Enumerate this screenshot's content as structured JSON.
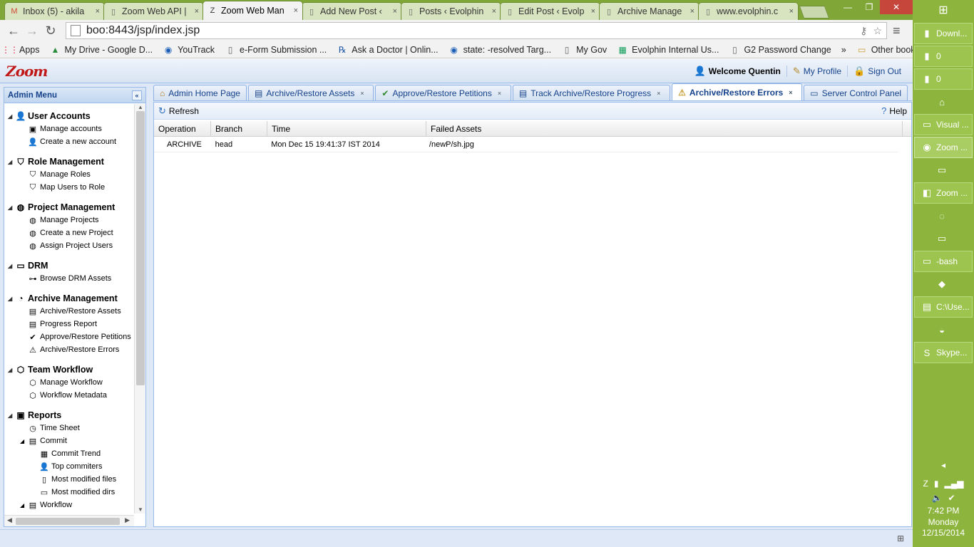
{
  "browser": {
    "tabs": [
      {
        "title": "Inbox (5) - akila",
        "icon": "gmail-icon",
        "glyph": "M",
        "color": "#d14836"
      },
      {
        "title": "Zoom Web API |",
        "icon": "page-icon",
        "glyph": "▯",
        "color": "#666"
      },
      {
        "title": "Zoom Web Man",
        "icon": "zoom-z-icon",
        "glyph": "Z",
        "color": "#333",
        "active": true
      },
      {
        "title": "Add New Post ‹",
        "icon": "page-icon",
        "glyph": "▯",
        "color": "#666"
      },
      {
        "title": "Posts ‹ Evolphin",
        "icon": "page-icon",
        "glyph": "▯",
        "color": "#666"
      },
      {
        "title": "Edit Post ‹ Evolp",
        "icon": "page-icon",
        "glyph": "▯",
        "color": "#666"
      },
      {
        "title": "Archive Manage",
        "icon": "page-icon",
        "glyph": "▯",
        "color": "#666"
      },
      {
        "title": "www.evolphin.c",
        "icon": "page-icon",
        "glyph": "▯",
        "color": "#666"
      }
    ],
    "tab_close": "×",
    "url": "boo:8443/jsp/index.jsp",
    "bookmarks": [
      {
        "label": "Apps",
        "icon": "apps-grid-icon",
        "glyph": "⋮⋮",
        "color": "#d24"
      },
      {
        "label": "My Drive - Google D...",
        "icon": "google-drive-icon",
        "glyph": "▲",
        "color": "#2a8c3a"
      },
      {
        "label": "YouTrack",
        "icon": "youtrack-icon",
        "glyph": "◉",
        "color": "#1b5fb8"
      },
      {
        "label": "e-Form Submission ...",
        "icon": "page-icon",
        "glyph": "▯",
        "color": "#666"
      },
      {
        "label": "Ask a Doctor | Onlin...",
        "icon": "rx-icon",
        "glyph": "℞",
        "color": "#1e57a8"
      },
      {
        "label": "state: -resolved Targ...",
        "icon": "youtrack-icon",
        "glyph": "◉",
        "color": "#1b5fb8"
      },
      {
        "label": "My Gov",
        "icon": "page-icon",
        "glyph": "▯",
        "color": "#666"
      },
      {
        "label": "Evolphin Internal Us...",
        "icon": "sheets-icon",
        "glyph": "▦",
        "color": "#0f9d58"
      },
      {
        "label": "G2 Password Change",
        "icon": "page-icon",
        "glyph": "▯",
        "color": "#666"
      }
    ],
    "bookmarks_more": "»",
    "other_bookmarks": "Other bookmarks"
  },
  "app": {
    "logo": "Zoom",
    "welcome": "Welcome Quentin",
    "my_profile": "My Profile",
    "sign_out": "Sign Out",
    "sidebar_title": "Admin Menu",
    "menu": [
      {
        "label": "User Accounts",
        "icon": "users-icon",
        "glyph": "👤",
        "items": [
          {
            "label": "Manage accounts",
            "icon": "manage-accounts-icon",
            "glyph": "▣"
          },
          {
            "label": "Create a new account",
            "icon": "add-user-icon",
            "glyph": "👤"
          }
        ]
      },
      {
        "label": "Role Management",
        "icon": "shield-icon",
        "glyph": "⛉",
        "items": [
          {
            "label": "Manage Roles",
            "icon": "roles-icon",
            "glyph": "⛉"
          },
          {
            "label": "Map Users to Role",
            "icon": "map-users-icon",
            "glyph": "⛉"
          }
        ]
      },
      {
        "label": "Project Management",
        "icon": "globe-icon",
        "glyph": "◍",
        "items": [
          {
            "label": "Manage Projects",
            "icon": "projects-icon",
            "glyph": "◍"
          },
          {
            "label": "Create a new Project",
            "icon": "new-project-icon",
            "glyph": "◍"
          },
          {
            "label": "Assign Project Users",
            "icon": "assign-users-icon",
            "glyph": "◍"
          }
        ]
      },
      {
        "label": "DRM",
        "icon": "folder-icon",
        "glyph": "▭",
        "items": [
          {
            "label": "Browse DRM Assets",
            "icon": "sitemap-icon",
            "glyph": "⊶"
          }
        ]
      },
      {
        "label": "Archive Management",
        "icon": "archive-icon",
        "glyph": "◔",
        "items": [
          {
            "label": "Archive/Restore Assets",
            "icon": "archive-assets-icon",
            "glyph": "▤"
          },
          {
            "label": "Progress Report",
            "icon": "report-icon",
            "glyph": "▤"
          },
          {
            "label": "Approve/Restore Petitions",
            "icon": "approve-shield-icon",
            "glyph": "✔"
          },
          {
            "label": "Archive/Restore Errors",
            "icon": "warning-icon",
            "glyph": "⚠"
          }
        ]
      },
      {
        "label": "Team Workflow",
        "icon": "workflow-icon",
        "glyph": "⬡",
        "items": [
          {
            "label": "Manage Workflow",
            "icon": "manage-workflow-icon",
            "glyph": "⬡"
          },
          {
            "label": "Workflow Metadata",
            "icon": "workflow-metadata-icon",
            "glyph": "⬡"
          }
        ]
      },
      {
        "label": "Reports",
        "icon": "reports-icon",
        "glyph": "▣",
        "items": [
          {
            "label": "Time Sheet",
            "icon": "clock-icon",
            "glyph": "◷"
          }
        ]
      }
    ],
    "reports_sub": {
      "commit": {
        "label": "Commit",
        "icon": "commit-icon",
        "glyph": "▤",
        "items": [
          {
            "label": "Commit Trend",
            "icon": "trend-icon",
            "glyph": "▦"
          },
          {
            "label": "Top commiters",
            "icon": "person-icon",
            "glyph": "👤"
          },
          {
            "label": "Most modified files",
            "icon": "files-icon",
            "glyph": "▯"
          },
          {
            "label": "Most modified dirs",
            "icon": "dirs-icon",
            "glyph": "▭"
          }
        ]
      },
      "workflow": {
        "label": "Workflow",
        "icon": "workflow-report-icon",
        "glyph": "▤"
      }
    },
    "tabs": [
      {
        "label": "Admin Home Page",
        "icon": "home-icon",
        "glyph": "⌂",
        "closable": false
      },
      {
        "label": "Archive/Restore Assets",
        "icon": "archive-assets-icon",
        "glyph": "▤",
        "closable": true
      },
      {
        "label": "Approve/Restore Petitions",
        "icon": "approve-shield-icon",
        "glyph": "✔",
        "closable": true
      },
      {
        "label": "Track Archive/Restore Progress",
        "icon": "report-icon",
        "glyph": "▤",
        "closable": true
      },
      {
        "label": "Archive/Restore Errors",
        "icon": "warning-icon",
        "glyph": "⚠",
        "closable": true,
        "active": true
      },
      {
        "label": "Server Control Panel",
        "icon": "monitor-icon",
        "glyph": "▭",
        "closable": false
      }
    ],
    "refresh": "Refresh",
    "help": "Help",
    "grid": {
      "columns": [
        "Operation",
        "Branch",
        "Time",
        "Failed Assets"
      ],
      "rows": [
        [
          "ARCHIVE",
          "head",
          "Mon Dec 15 19:41:37 IST 2014",
          "/newP/sh.jpg"
        ]
      ]
    }
  },
  "taskbar": {
    "items": [
      {
        "label": "Downl...",
        "icon": "folder-icon",
        "glyph": "▮"
      },
      {
        "label": "0",
        "icon": "folder-icon",
        "glyph": "▮"
      },
      {
        "label": "0",
        "icon": "folder-icon",
        "glyph": "▮"
      },
      {
        "label": "",
        "icon": "home-icon",
        "glyph": "⌂"
      },
      {
        "label": "Visual ...",
        "icon": "cmd-icon",
        "glyph": "▭"
      },
      {
        "label": "Zoom ...",
        "icon": "chrome-icon",
        "glyph": "◉"
      },
      {
        "label": "",
        "icon": "cmd-icon",
        "glyph": "▭"
      },
      {
        "label": "Zoom ...",
        "icon": "intellij-icon",
        "glyph": "◧"
      },
      {
        "label": "",
        "icon": "airtel-icon",
        "glyph": "◌"
      },
      {
        "label": "",
        "icon": "monitor-icon",
        "glyph": "▭"
      },
      {
        "label": "-bash",
        "icon": "terminal-icon",
        "glyph": "▭"
      },
      {
        "label": "",
        "icon": "virtualbox-icon",
        "glyph": "◆"
      },
      {
        "label": "C:\\Use...",
        "icon": "notepad-icon",
        "glyph": "▤"
      },
      {
        "label": "",
        "icon": "paint-icon",
        "glyph": "◒"
      },
      {
        "label": "Skype...",
        "icon": "skype-icon",
        "glyph": "S"
      }
    ],
    "time": "7:42 PM",
    "day": "Monday",
    "date": "12/15/2014"
  }
}
